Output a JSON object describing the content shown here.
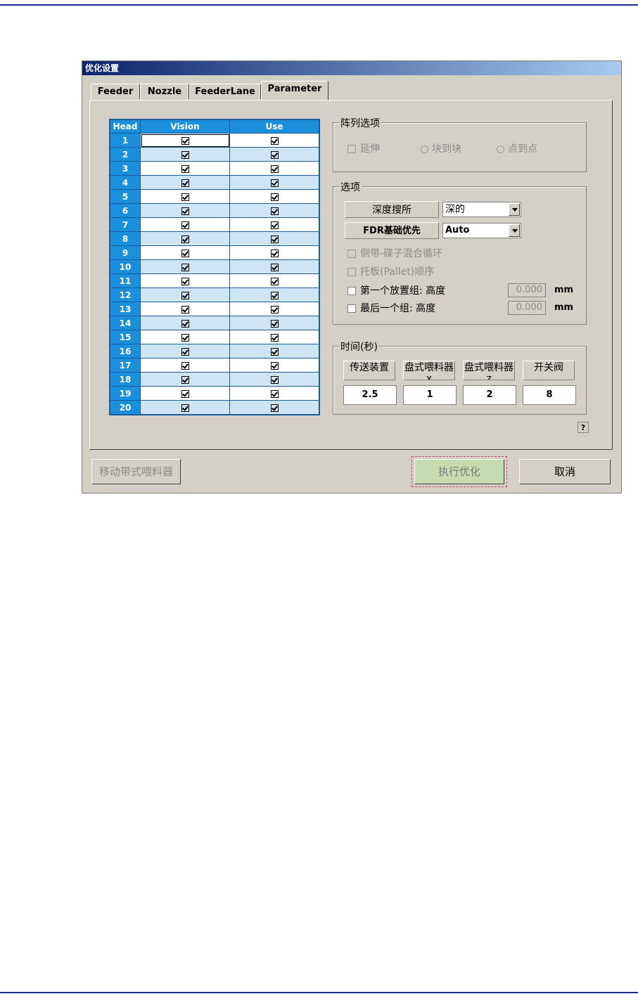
{
  "window": {
    "title": "优化设置"
  },
  "tabs": [
    "Feeder",
    "Nozzle",
    "FeederLane",
    "Parameter"
  ],
  "head_table": {
    "columns": [
      "Head",
      "Vision",
      "Use"
    ],
    "rows": [
      "1",
      "2",
      "3",
      "4",
      "5",
      "6",
      "7",
      "8",
      "9",
      "10",
      "11",
      "12",
      "13",
      "14",
      "15",
      "16",
      "17",
      "18",
      "19",
      "20"
    ]
  },
  "array_options": {
    "legend": "阵列选项",
    "extend_label": "延伸",
    "block_to_block_label": "块到块",
    "point_to_point_label": "点到点"
  },
  "options": {
    "legend": "选项",
    "depth_search_label": "深度搜所",
    "depth_search_value": "深的",
    "fdr_priority_label": "FDR基础优先",
    "fdr_priority_value": "Auto",
    "side_mixed_label": "侧带-碟子混合循环",
    "pallet_order_label": "托板(Pallet)顺序",
    "first_group_label": "第一个放置组: 高度",
    "first_group_value": "0.000",
    "last_group_label": "最后一个组: 高度",
    "last_group_value": "0.000",
    "unit": "mm"
  },
  "time": {
    "legend": "时间(秒)",
    "headers": [
      "传送装置",
      "盘式喂料器x",
      "盘式喂料器z",
      "开关阀"
    ],
    "values": [
      "2.5",
      "1",
      "2",
      "8"
    ]
  },
  "help_label": "?",
  "buttons": {
    "move_feeder": "移动带式喂料器",
    "run": "执行优化",
    "cancel": "取消"
  }
}
